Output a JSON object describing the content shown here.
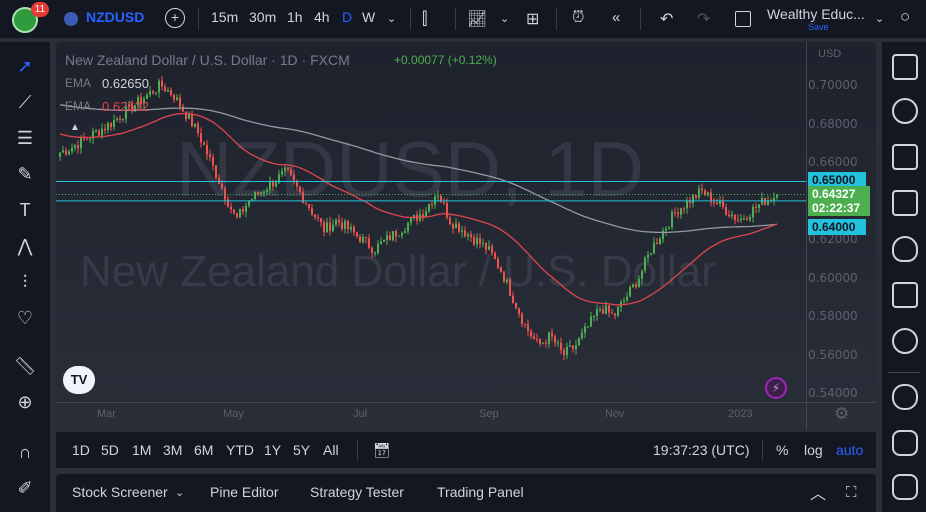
{
  "topbar": {
    "badge": "11",
    "symbol": "NZDUSD",
    "intervals": [
      "15m",
      "30m",
      "1h",
      "4h",
      "D",
      "W"
    ],
    "active_interval": "D",
    "layout_name": "Wealthy Educ...",
    "save_label": "Save"
  },
  "legend": {
    "title": "New Zealand Dollar / U.S. Dollar · 1D · FXCM",
    "change": "+0.00077 (+0.12%)",
    "ema1_label": "EMA",
    "ema1_value": "0.62650",
    "ema2_label": "EMA",
    "ema2_value": "0.62632"
  },
  "watermark": {
    "symbol": "NZDUSD, 1D",
    "name": "New Zealand Dollar / U.S. Dollar"
  },
  "price_axis": {
    "currency": "USD",
    "ticks": [
      "0.70000",
      "0.68000",
      "0.66000",
      "0.62000",
      "0.60000",
      "0.58000",
      "0.56000",
      "0.54000"
    ],
    "tick_values": [
      0.7,
      0.68,
      0.66,
      0.62,
      0.6,
      0.58,
      0.56,
      0.54
    ],
    "level_high": "0.65000",
    "level_low": "0.64000",
    "last_price": "0.64327",
    "countdown": "02:22:37"
  },
  "time_axis": {
    "labels": [
      "Mar",
      "May",
      "Jul",
      "Sep",
      "Nov",
      "2023"
    ]
  },
  "colors": {
    "up": "#26a69a",
    "up_bar": "#4caf50",
    "down": "#ef5350",
    "ema_fast": "#e0464f",
    "ema_slow": "#9598a1",
    "level": "#22c1dc",
    "accent": "#2962ff"
  },
  "chart_data": {
    "type": "candlestick",
    "weekly_closes": [
      0.665,
      0.668,
      0.672,
      0.676,
      0.68,
      0.685,
      0.69,
      0.695,
      0.7,
      0.695,
      0.685,
      0.675,
      0.66,
      0.645,
      0.63,
      0.64,
      0.645,
      0.65,
      0.655,
      0.645,
      0.635,
      0.625,
      0.63,
      0.625,
      0.62,
      0.615,
      0.62,
      0.625,
      0.63,
      0.635,
      0.645,
      0.63,
      0.625,
      0.62,
      0.615,
      0.605,
      0.59,
      0.575,
      0.565,
      0.57,
      0.56,
      0.565,
      0.575,
      0.585,
      0.58,
      0.59,
      0.6,
      0.615,
      0.625,
      0.635,
      0.64,
      0.645,
      0.64,
      0.635,
      0.63,
      0.635,
      0.64,
      0.643
    ],
    "ylim": [
      0.54,
      0.7
    ]
  },
  "bottom_toolbar": {
    "ranges": [
      "1D",
      "5D",
      "1M",
      "3M",
      "6M",
      "YTD",
      "1Y",
      "5Y",
      "All"
    ],
    "clock": "19:37:23 (UTC)",
    "percent": "%",
    "log": "log",
    "auto": "auto"
  },
  "bottom_panel": {
    "tabs": [
      "Stock Screener",
      "Pine Editor",
      "Strategy Tester",
      "Trading Panel"
    ]
  }
}
